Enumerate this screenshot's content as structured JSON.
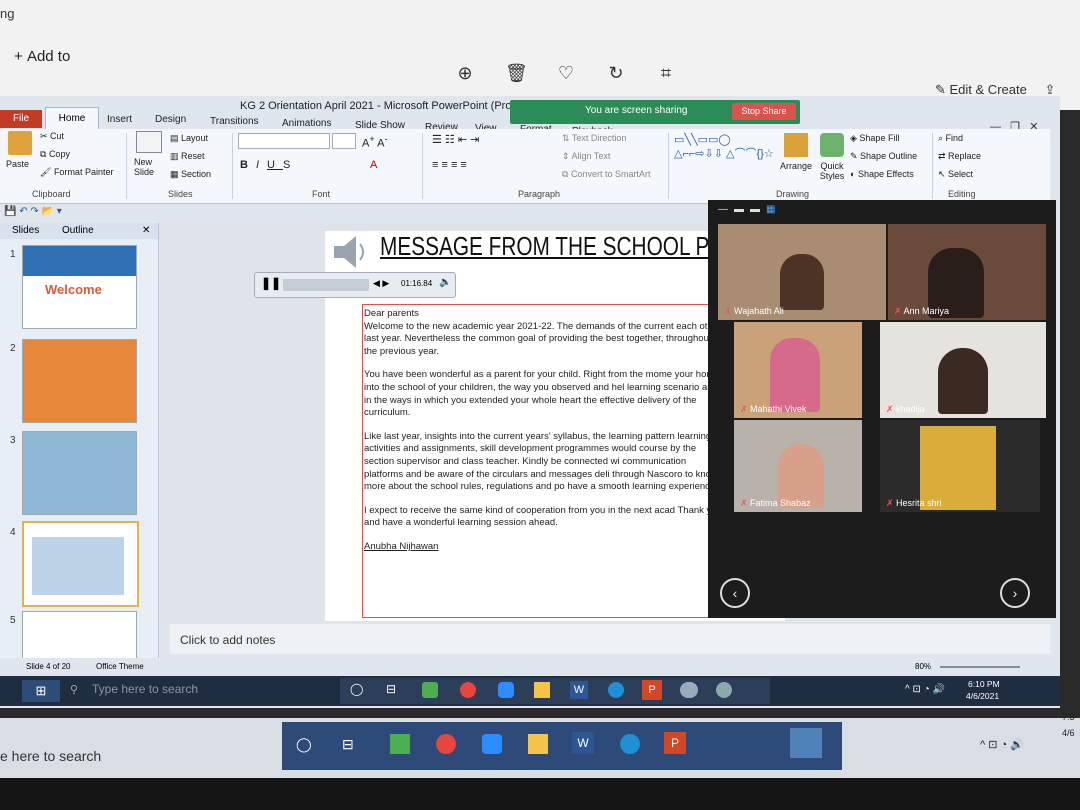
{
  "viewer": {
    "app_label": "ng",
    "add_to": "Add to",
    "edit_create": "Edit & Create",
    "outer_search": "e here to search",
    "outer_clock": "7:3",
    "outer_date": "4/6"
  },
  "window": {
    "title": "KG 2 Orientation April 2021  -  Microsoft PowerPoint (Product Activation Failed)"
  },
  "share": {
    "status": "You are screen sharing",
    "stop": "Stop Share"
  },
  "ribbon": {
    "file_tab": "File",
    "tabs": [
      "Home",
      "Insert",
      "Design",
      "Transitions",
      "Animations",
      "Slide Show",
      "Review",
      "View",
      "Format",
      "Playback"
    ],
    "clipboard": {
      "paste": "Paste",
      "cut": "Cut",
      "copy": "Copy",
      "format_painter": "Format Painter",
      "label": "Clipboard"
    },
    "slides": {
      "new_slide": "New Slide",
      "layout": "Layout",
      "reset": "Reset",
      "section": "Section",
      "label": "Slides"
    },
    "font": {
      "label": "Font"
    },
    "paragraph": {
      "text_direction": "Text Direction",
      "align_text": "Align Text",
      "convert": "Convert to SmartArt",
      "label": "Paragraph"
    },
    "drawing": {
      "arrange": "Arrange",
      "quick_styles": "Quick Styles",
      "shape_fill": "Shape Fill",
      "shape_outline": "Shape Outline",
      "shape_effects": "Shape Effects",
      "label": "Drawing"
    },
    "editing": {
      "find": "Find",
      "replace": "Replace",
      "select": "Select",
      "label": "Editing"
    }
  },
  "pane": {
    "tabs": [
      "Slides",
      "Outline"
    ],
    "slide_numbers": [
      "1",
      "2",
      "3",
      "4",
      "5"
    ],
    "slide1_text": "Welcome"
  },
  "slide": {
    "title": "MESSAGE FROM THE SCHOOL PRINCIPAL",
    "media_time": "01:16.84",
    "greeting": "Dear parents",
    "paragraphs": [
      "Welcome to the new academic year 2021-22.   The demands of the current each other last year. Nevertheless the common goal of providing the best together, throughout the previous year.",
      "You have been wonderful as a parent for your child. Right from the mome your home into the school of your children, the way you observed and hel learning scenario and in the ways in which you extended your whole heart the effective delivery of the curriculum.",
      "Like last year, insights into the current years' syllabus, the learning pattern learning activities and assignments, skill development programmes would course by the section supervisor and class teacher. Kindly be connected wi communication platforms and be aware of the circulars and messages deli through Nascoro to know more about the school rules, regulations and po have a smooth learning experience.",
      "I expect to receive the same kind of cooperation from you in the next acad Thank you and have a wonderful learning session ahead."
    ],
    "signature": "Anubha Nijhawan"
  },
  "participants": [
    {
      "name": "Wajahath Ali"
    },
    {
      "name": "Ann Mariya"
    },
    {
      "name": "Mahathi Vivek"
    },
    {
      "name": "khadija"
    },
    {
      "name": "Fatima Shabaz"
    },
    {
      "name": "Hesrita shri"
    }
  ],
  "notes": {
    "placeholder": "Click to add notes"
  },
  "status": {
    "slide": "Slide 4 of 20",
    "theme": "Office Theme",
    "zoom": "80%"
  },
  "taskbar": {
    "search": "Type here to search",
    "time": "6:10 PM",
    "date": "4/6/2021"
  }
}
